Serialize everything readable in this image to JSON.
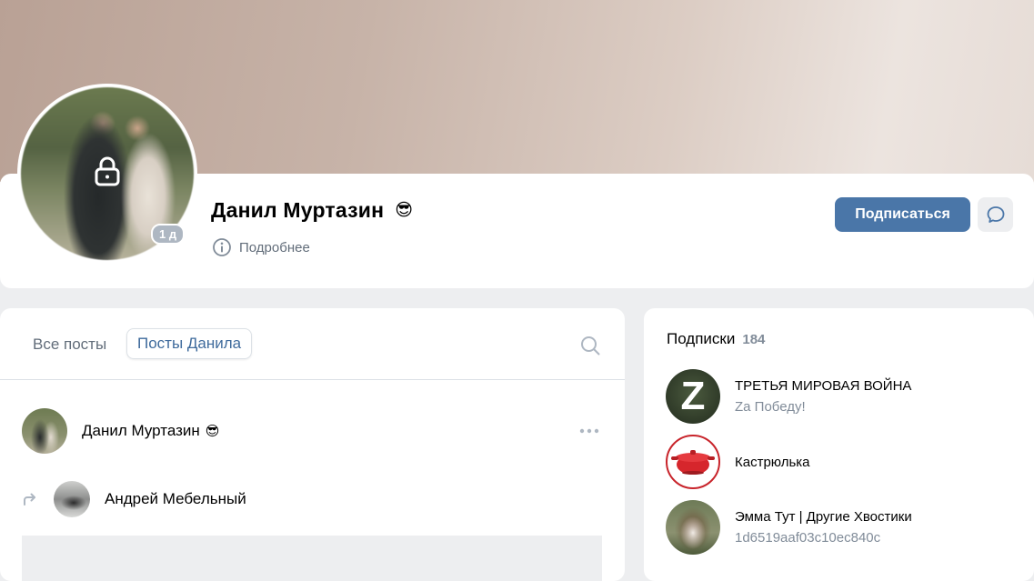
{
  "profile": {
    "name": "Данил Муртазин",
    "name_emoji": "😎",
    "avatar_badge": "1 д",
    "details_label": "Подробнее",
    "subscribe_label": "Подписаться"
  },
  "feed": {
    "tabs": [
      {
        "label": "Все посты",
        "active": false
      },
      {
        "label": "Посты Данила",
        "active": true
      }
    ],
    "post": {
      "author": "Данил Муртазин",
      "author_emoji": "😎",
      "repost_author": "Андрей Мебельный"
    }
  },
  "subscriptions": {
    "title": "Подписки",
    "count": "184",
    "items": [
      {
        "name": "ТРЕТЬЯ МИРОВАЯ ВОЙНА",
        "description": "Za Победу!",
        "avatar_letter": "Z"
      },
      {
        "name": "Кастрюлька",
        "description": ""
      },
      {
        "name": "Эмма Тут | Другие Хвостики",
        "description": "1d6519aaf03c10ec840c"
      }
    ]
  },
  "colors": {
    "accent": "#4a76a8",
    "link": "#3f6b9c",
    "secondary_text": "#818c99",
    "background": "#edeef0"
  }
}
